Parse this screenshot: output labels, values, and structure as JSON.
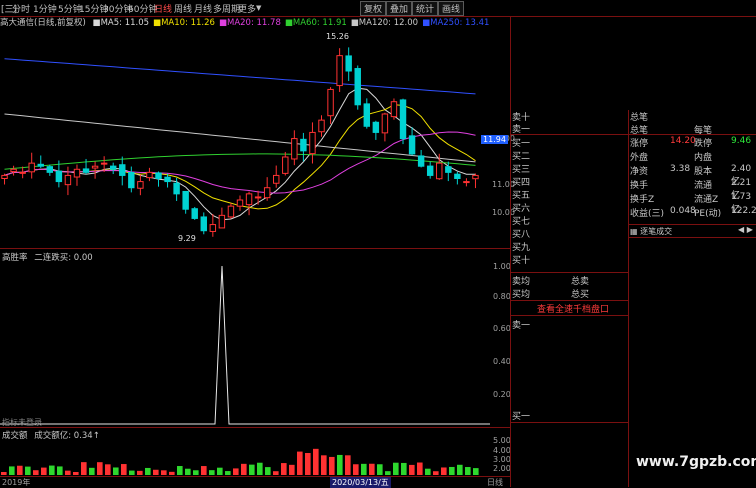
{
  "toolbar": {
    "left_btn": "[三]",
    "periods": [
      "分时",
      "1分钟",
      "5分钟",
      "15分钟",
      "30分钟",
      "60分钟",
      "日线",
      "周线",
      "月线",
      "多周期",
      "更多"
    ],
    "active_period": "日线",
    "right_btns": [
      "复权",
      "叠加",
      "统计",
      "画线"
    ]
  },
  "stock_title": "高大通信(日线,前复权)",
  "ma_legend": [
    {
      "label": "MA5: 11.05",
      "color": "#d8d8d8"
    },
    {
      "label": "MA10: 11.26",
      "color": "#f0e000"
    },
    {
      "label": "MA20: 11.78",
      "color": "#e040e0"
    },
    {
      "label": "MA60: 11.91",
      "color": "#30d030"
    },
    {
      "label": "MA120: 12.00",
      "color": "#c8c8c8"
    },
    {
      "label": "MA250: 13.41",
      "color": "#3050ff"
    }
  ],
  "price_annotations": {
    "high": "15.26",
    "low": "9.29",
    "current": "11.94"
  },
  "price_axis": [
    "12.00",
    "11.00",
    "10.00"
  ],
  "indicator1": {
    "title": "高胜率",
    "sub": "二连跌买: 0.00",
    "axis": [
      "1.00",
      "0.80",
      "0.60",
      "0.40",
      "0.20"
    ],
    "note": "指标未登录"
  },
  "indicator2": {
    "title": "成交额",
    "sub": "成交额亿: 0.34↑",
    "axis": [
      "5.00",
      "4.00",
      "3.00",
      "2.00",
      "1.00"
    ]
  },
  "date_axis": {
    "start": "2019年",
    "highlight": "2020/03/13/五",
    "end": "日线"
  },
  "order_book": {
    "sell_labels": [
      "卖十",
      "卖一"
    ],
    "total_label": "总笔",
    "per_label": "每笔",
    "buy_labels": [
      "买一",
      "买二",
      "买三",
      "买四",
      "买五",
      "买六",
      "买七",
      "买八",
      "买九",
      "买十"
    ],
    "sell_avg": "卖均",
    "buy_avg": "买均",
    "total_sell": "总卖",
    "total_buy": "总买",
    "link": "查看全速千档盘口"
  },
  "stats": [
    {
      "l1": "涨停",
      "v1": "14.20",
      "l2": "跌停",
      "v2": "9.46",
      "c1": "red",
      "c2": "green"
    },
    {
      "l1": "外盘",
      "v1": "",
      "l2": "内盘",
      "v2": "",
      "c1": "",
      "c2": ""
    },
    {
      "l1": "净资",
      "v1": "3.38",
      "l2": "股本",
      "v2": "2.40亿",
      "c1": "",
      "c2": ""
    },
    {
      "l1": "换手",
      "v1": "",
      "l2": "流通",
      "v2": "2.21亿",
      "c1": "",
      "c2": ""
    },
    {
      "l1": "换手Z",
      "v1": "",
      "l2": "流通Z",
      "v2": "1.73亿",
      "c1": "",
      "c2": ""
    },
    {
      "l1": "收益(三)",
      "v1": "0.048",
      "l2": "PE(动)",
      "v2": "122.2",
      "c1": "",
      "c2": ""
    }
  ],
  "trades_header": "逐笔成交",
  "watermark": "www.7gpzb.com",
  "chart_data": {
    "type": "candlestick",
    "ylim": [
      9.0,
      16.0
    ],
    "closes": [
      11.2,
      11.4,
      11.3,
      11.6,
      11.5,
      11.3,
      11.0,
      11.2,
      11.4,
      11.3,
      11.5,
      11.6,
      11.4,
      11.2,
      10.8,
      11.0,
      11.3,
      11.1,
      11.0,
      10.6,
      10.1,
      9.8,
      9.4,
      9.6,
      9.9,
      10.2,
      10.4,
      10.6,
      10.5,
      10.8,
      11.2,
      11.8,
      12.4,
      12.0,
      12.6,
      13.0,
      14.0,
      15.1,
      14.6,
      13.5,
      12.8,
      12.6,
      13.2,
      13.6,
      12.4,
      11.9,
      11.5,
      11.2,
      11.6,
      11.3,
      11.1,
      11.0,
      11.2
    ]
  }
}
